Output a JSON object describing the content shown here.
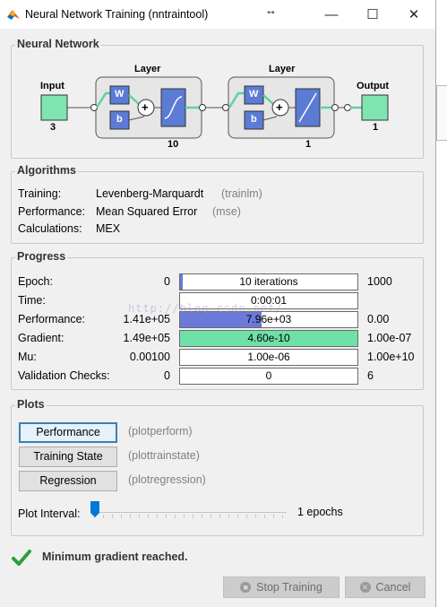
{
  "window": {
    "title": "Neural Network Training (nntraintool)",
    "resize_glyph": "↔",
    "minimize_glyph": "—",
    "maximize_glyph": "☐",
    "close_glyph": "✕"
  },
  "network": {
    "section": "Neural Network",
    "input_label": "Input",
    "input_size": "3",
    "layer1_label": "Layer",
    "layer1_size": "10",
    "layer2_label": "Layer",
    "layer2_size": "1",
    "output_label": "Output",
    "output_size": "1",
    "weight_glyph": "W",
    "bias_glyph": "b",
    "sum_glyph": "+"
  },
  "algorithms": {
    "section": "Algorithms",
    "rows": [
      {
        "label": "Training:",
        "value": "Levenberg-Marquardt",
        "fn": "(trainlm)"
      },
      {
        "label": "Performance:",
        "value": "Mean Squared Error",
        "fn": "(mse)"
      },
      {
        "label": "Calculations:",
        "value": "MEX",
        "fn": ""
      }
    ]
  },
  "progress": {
    "section": "Progress",
    "rows": [
      {
        "label": "Epoch:",
        "start": "0",
        "current": "10 iterations",
        "end": "1000",
        "fill": 0.01,
        "fill_color": "#6b79d8"
      },
      {
        "label": "Time:",
        "start": "",
        "current": "0:00:01",
        "end": "",
        "fill": 0,
        "fill_color": "#6b79d8"
      },
      {
        "label": "Performance:",
        "start": "1.41e+05",
        "current": "7.96e+03",
        "end": "0.00",
        "fill": 0.46,
        "fill_color": "#6b79d8"
      },
      {
        "label": "Gradient:",
        "start": "1.49e+05",
        "current": "4.60e-10",
        "end": "1.00e-07",
        "fill": 1,
        "fill_color": "#6ee0a8"
      },
      {
        "label": "Mu:",
        "start": "0.00100",
        "current": "1.00e-06",
        "end": "1.00e+10",
        "fill": 0,
        "fill_color": "#6b79d8"
      },
      {
        "label": "Validation Checks:",
        "start": "0",
        "current": "0",
        "end": "6",
        "fill": 0,
        "fill_color": "#6b79d8"
      }
    ]
  },
  "plots": {
    "section": "Plots",
    "buttons": [
      {
        "label": "Performance",
        "fn": "(plotperform)"
      },
      {
        "label": "Training State",
        "fn": "(plottrainstate)"
      },
      {
        "label": "Regression",
        "fn": "(plotregression)"
      }
    ],
    "interval_label": "Plot Interval:",
    "interval_value": "1 epochs",
    "interval_fraction": 0
  },
  "status": {
    "message": "Minimum gradient reached.",
    "icon": "checkmark-icon"
  },
  "footer": {
    "stop_label": "Stop Training",
    "cancel_label": "Cancel"
  },
  "watermark": "http://blog.csdn.net/"
}
